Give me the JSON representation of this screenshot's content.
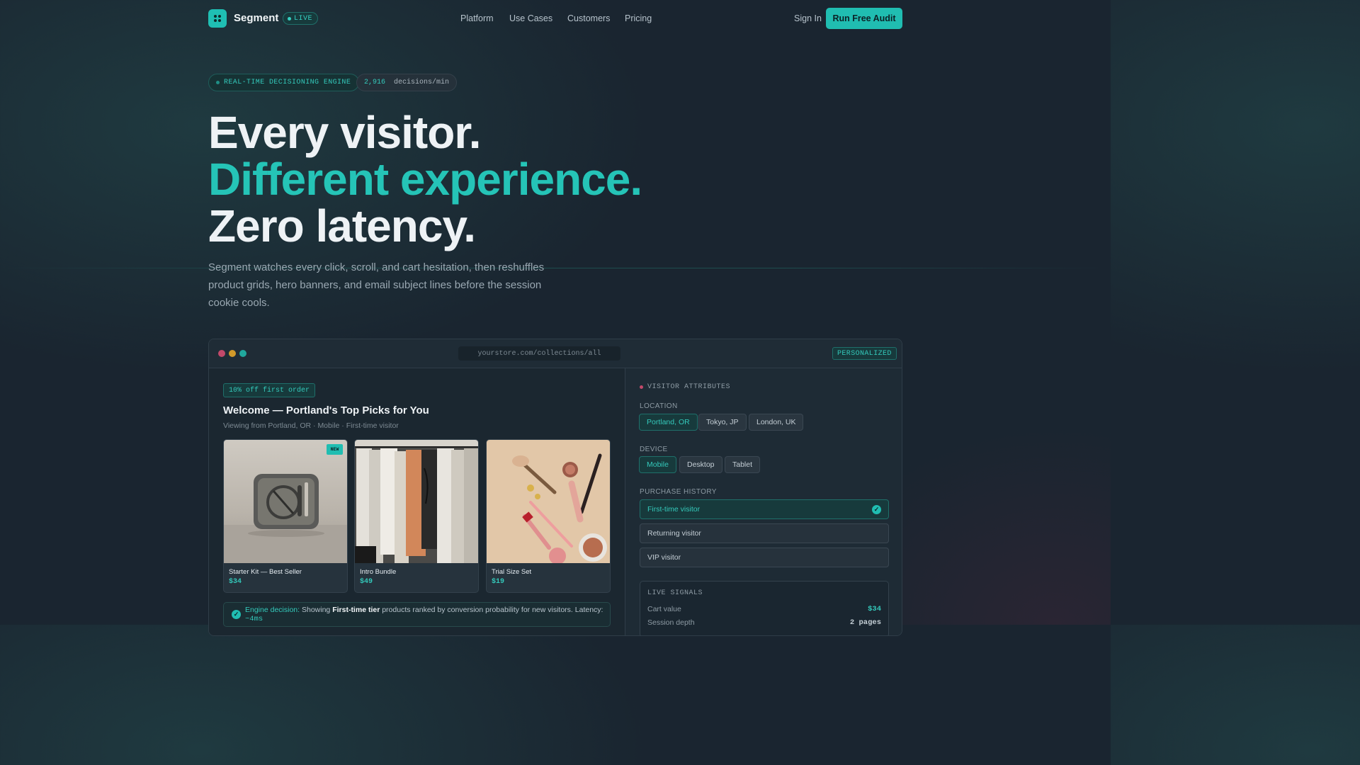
{
  "nav": {
    "brand": "Segment",
    "live_label": "LIVE",
    "links": [
      "Platform",
      "Use Cases",
      "Customers",
      "Pricing"
    ],
    "sign_in": "Sign In",
    "cta": "Run Free Audit"
  },
  "hero": {
    "badge_engine": "REAL-TIME DECISIONING ENGINE",
    "decisions_count": "2,916",
    "decisions_unit": "decisions/min",
    "headline_1": "Every visitor.",
    "headline_2": "Different experience.",
    "headline_3": "Zero latency.",
    "subtitle": "Segment watches every click, scroll, and cart hesitation, then reshuffles product grids, hero banners, and email subject lines before the session cookie cools."
  },
  "browser": {
    "url": "yourstore.com/collections/all",
    "personalized_badge": "PERSONALIZED",
    "promo": "10% off first order",
    "welcome": "Welcome — Portland's Top Picks for You",
    "viewing": "Viewing from Portland, OR · Mobile · First-time visitor",
    "products": [
      {
        "name": "Starter Kit — Best Seller",
        "price": "$34",
        "tag": "NEW"
      },
      {
        "name": "Intro Bundle",
        "price": "$49"
      },
      {
        "name": "Trial Size Set",
        "price": "$19"
      }
    ],
    "decision": {
      "label": "Engine decision:",
      "text1": "Showing",
      "tier": "First-time tier",
      "text2": "products ranked by conversion probability for new visitors. Latency:",
      "latency": "~4ms"
    }
  },
  "attributes": {
    "title": "VISITOR ATTRIBUTES",
    "location_label": "LOCATION",
    "locations": [
      "Portland, OR",
      "Tokyo, JP",
      "London, UK"
    ],
    "device_label": "DEVICE",
    "devices": [
      "Mobile",
      "Desktop",
      "Tablet"
    ],
    "history_label": "PURCHASE HISTORY",
    "history": [
      "First-time visitor",
      "Returning visitor",
      "VIP visitor"
    ],
    "signals_title": "LIVE SIGNALS",
    "signals": [
      {
        "label": "Cart value",
        "value": "$34"
      },
      {
        "label": "Session depth",
        "value": "2 pages"
      }
    ]
  },
  "colors": {
    "accent": "#20bdb1",
    "background": "#1a2530",
    "traffic_red": "#c2496a",
    "traffic_yellow": "#d19a2a",
    "traffic_green": "#20a89d"
  }
}
